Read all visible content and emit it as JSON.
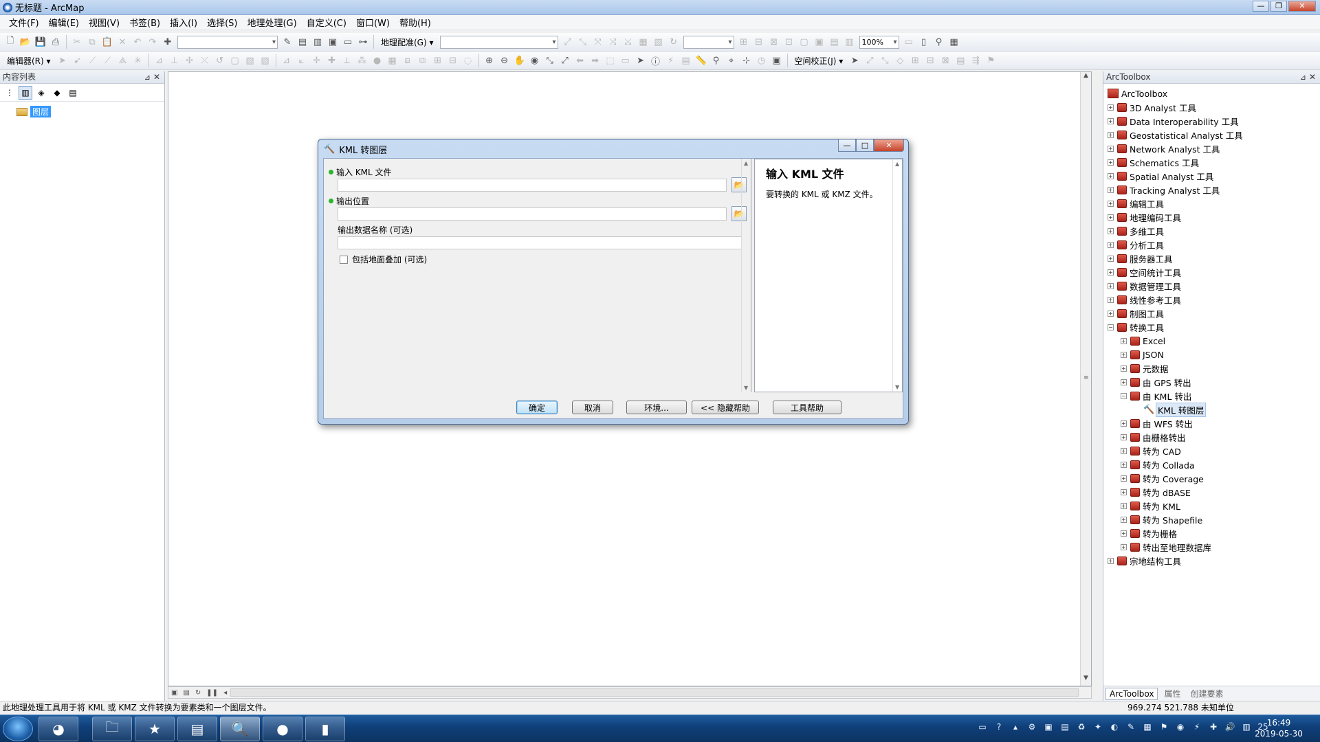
{
  "window": {
    "title": "无标题 - ArcMap"
  },
  "menu": [
    "文件(F)",
    "编辑(E)",
    "视图(V)",
    "书签(B)",
    "插入(I)",
    "选择(S)",
    "地理处理(G)",
    "自定义(C)",
    "窗口(W)",
    "帮助(H)"
  ],
  "toolbar": {
    "georef_label": "地理配准(G) ▾",
    "zoom_value": "100%",
    "editor_label": "编辑器(R) ▾",
    "spatial_adjust_label": "空间校正(J) ▾"
  },
  "toc": {
    "title": "内容列表",
    "layer_label": "图层"
  },
  "dialog": {
    "title": "KML 转图层",
    "input_label": "输入 KML 文件",
    "output_label": "输出位置",
    "name_label": "输出数据名称 (可选)",
    "ground_label": "包括地面叠加 (可选)",
    "help_title": "输入 KML 文件",
    "help_text": "要转换的 KML 或 KMZ 文件。",
    "buttons": {
      "ok": "确定",
      "cancel": "取消",
      "env": "环境...",
      "hide_help": "<< 隐藏帮助",
      "tool_help": "工具帮助"
    }
  },
  "toolbox": {
    "title": "ArcToolbox",
    "root": "ArcToolbox",
    "items": [
      "3D Analyst 工具",
      "Data Interoperability 工具",
      "Geostatistical Analyst 工具",
      "Network Analyst 工具",
      "Schematics 工具",
      "Spatial Analyst 工具",
      "Tracking Analyst 工具",
      "编辑工具",
      "地理编码工具",
      "多维工具",
      "分析工具",
      "服务器工具",
      "空间统计工具",
      "数据管理工具",
      "线性参考工具",
      "制图工具",
      "转换工具"
    ],
    "sub_items": [
      "Excel",
      "JSON",
      "元数据",
      "由 GPS 转出",
      "由 KML 转出"
    ],
    "tool": "KML 转图层",
    "sub_items2": [
      "由 WFS 转出",
      "由栅格转出",
      "转为 CAD",
      "转为 Collada",
      "转为 Coverage",
      "转为 dBASE",
      "转为 KML",
      "转为 Shapefile",
      "转为栅格",
      "转出至地理数据库"
    ],
    "last_item": "宗地结构工具",
    "tabs": [
      "ArcToolbox",
      "属性",
      "创建要素"
    ]
  },
  "status": {
    "message": "此地理处理工具用于将 KML 或 KMZ 文件转换为要素类和一个图层文件。",
    "coords": "969.274  521.788 未知单位"
  },
  "taskbar": {
    "time": "16:49",
    "date": "2019-05-30",
    "badge": "25"
  }
}
